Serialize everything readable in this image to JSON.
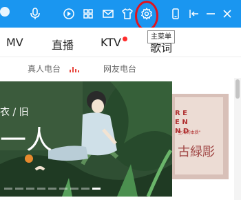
{
  "titlebar": {
    "color": "#1a96f0",
    "icons": [
      "user-icon",
      "microphone-icon",
      "play-icon",
      "grid-icon",
      "mail-icon",
      "tshirt-icon",
      "gear-icon",
      "phone-icon",
      "collapse-icon",
      "minimize-icon",
      "close-icon"
    ]
  },
  "tooltip": {
    "text": "主菜单"
  },
  "nav": {
    "items": [
      {
        "label": "MV"
      },
      {
        "label": "直播"
      },
      {
        "label": "KTV"
      },
      {
        "label": "歌词"
      }
    ]
  },
  "subnav": {
    "items": [
      {
        "label": "真人电台"
      },
      {
        "label": "网友电台"
      }
    ]
  },
  "banner": {
    "line1": "衣 / 旧",
    "line2": "一人"
  },
  "side_card": {
    "letters": "R E\nE N\nN D",
    "small_text": "\"生活的本质\"",
    "brand": "古緑彫"
  }
}
